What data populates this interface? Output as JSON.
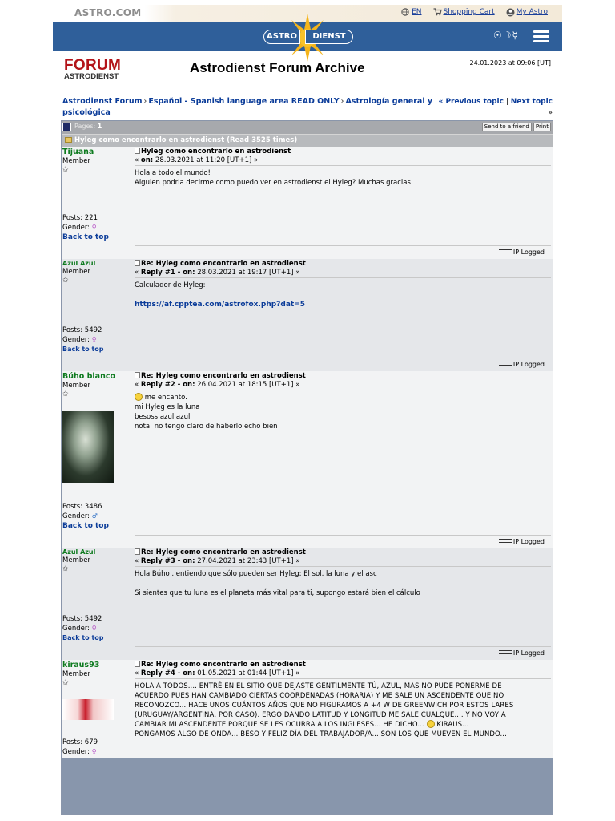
{
  "topbar": {
    "brand": "ASTRO.COM",
    "lang": "EN",
    "cart": "Shopping Cart",
    "account": "My Astro"
  },
  "banner": {
    "logo_left": "ASTRO",
    "logo_right": "DIENST",
    "planet_symbols": "☉☽☿"
  },
  "header": {
    "forum_logo_1": "FORUM",
    "forum_logo_2": "ASTRODIENST",
    "title": "Astrodienst Forum Archive",
    "datetime": "24.01.2023 at 09:06 [UT]"
  },
  "breadcrumb": {
    "items": [
      "Astrodienst Forum",
      "Español - Spanish language area READ ONLY",
      "Astrología general y psicológica"
    ],
    "separator": "›",
    "prev_label": "« Previous topic",
    "divider": "|",
    "next_label": "Next topic",
    "next_suffix": "»"
  },
  "pages": {
    "label": "Pages:",
    "number": "1",
    "send_friend": "Send to a friend",
    "print": "Print"
  },
  "topic": {
    "title": "Hyleg como encontrarlo en astrodienst  (Read 3525 times)"
  },
  "labels": {
    "member": "Member",
    "posts": "Posts:",
    "gender": "Gender:",
    "back_to_top": "Back to top",
    "ip_logged": "IP Logged",
    "on": "on:"
  },
  "posts": [
    {
      "author": "Tijuana",
      "posts": "221",
      "gender": "female",
      "subject": "Hyleg como encontrarlo en astrodienst",
      "meta_prefix": "«",
      "meta_label": "on:",
      "meta_date": "28.03.2021 at 11:20 [UT+1] »",
      "lines": [
        "Hola a todo el mundo!",
        "Alguien podria decirme como puedo ver en astrodienst el Hyleg? Muchas gracias"
      ]
    },
    {
      "author": "Azul Azul",
      "posts": "5492",
      "gender": "female",
      "subject": "Re: Hyleg como encontrarlo en astrodienst",
      "meta_prefix": "«",
      "meta_label": "Reply #1 - on:",
      "meta_date": "28.03.2021 at 19:17 [UT+1] »",
      "lines": [
        "Calculador de Hyleg:"
      ],
      "link": "https://af.cpptea.com/astrofox.php?dat=5"
    },
    {
      "author": "Búho blanco",
      "posts": "3486",
      "gender": "male",
      "subject": "Re: Hyleg como encontrarlo en astrodienst",
      "meta_prefix": "«",
      "meta_label": "Reply #2 - on:",
      "meta_date": "26.04.2021 at 18:15 [UT+1] »",
      "lines": [
        "me encanto.",
        "mi Hyleg es la luna",
        "besoss azul azul",
        "nota: no tengo claro de haberlo echo bien"
      ]
    },
    {
      "author": "Azul Azul",
      "posts": "5492",
      "gender": "female",
      "subject": "Re: Hyleg como encontrarlo en astrodienst",
      "meta_prefix": "«",
      "meta_label": "Reply #3 - on:",
      "meta_date": "27.04.2021 at 23:43 [UT+1] »",
      "lines": [
        "Hola Búho , entiendo que sólo pueden ser Hyleg: El sol, la luna y el asc",
        "Si sientes que tu luna es el planeta más vital para ti, supongo estará bien el cálculo"
      ]
    },
    {
      "author": "kiraus93",
      "posts": "679",
      "gender": "female",
      "subject": "Re: Hyleg como encontrarlo en astrodienst",
      "meta_prefix": "«",
      "meta_label": "Reply #4 - on:",
      "meta_date": "01.05.2021 at 01:44 [UT+1] »",
      "lines": [
        "HOLA A TODOS.... ENTRÉ EN EL SITIO QUE DEJASTE GENTILMENTE TÚ, AZUL, MAS NO PUDE PONERME DE",
        "ACUERDO PUES HAN CAMBIADO CIERTAS COORDENADAS (HORARIA) Y ME SALE UN ASCENDENTE QUE NO",
        "RECONOZCO... HACE UNOS CUÁNTOS AÑOS QUE NO FIGURAMOS A +4 W DE GREENWICH POR ESTOS LARES",
        "(URUGUAY/ARGENTINA, POR CASO).  ERGO DANDO LATITUD Y LONGITUD ME SALE CUALQUE.... Y NO VOY A",
        "CAMBIAR MI ASCENDENTE PORQUE SE LES OCURRA A LOS INGLESES... HE DICHO...",
        "KIRAUS...",
        "PONGAMOS ALGO DE ONDA... BESO Y FELIZ DÍA DEL TRABAJADOR/A... SON LOS QUE MUEVEN EL MUNDO..."
      ]
    }
  ],
  "colors": {
    "banner": "#2f5f9a",
    "author_name": "#0d7a1e",
    "link": "#0b3c99",
    "forum_red": "#b3141a"
  }
}
